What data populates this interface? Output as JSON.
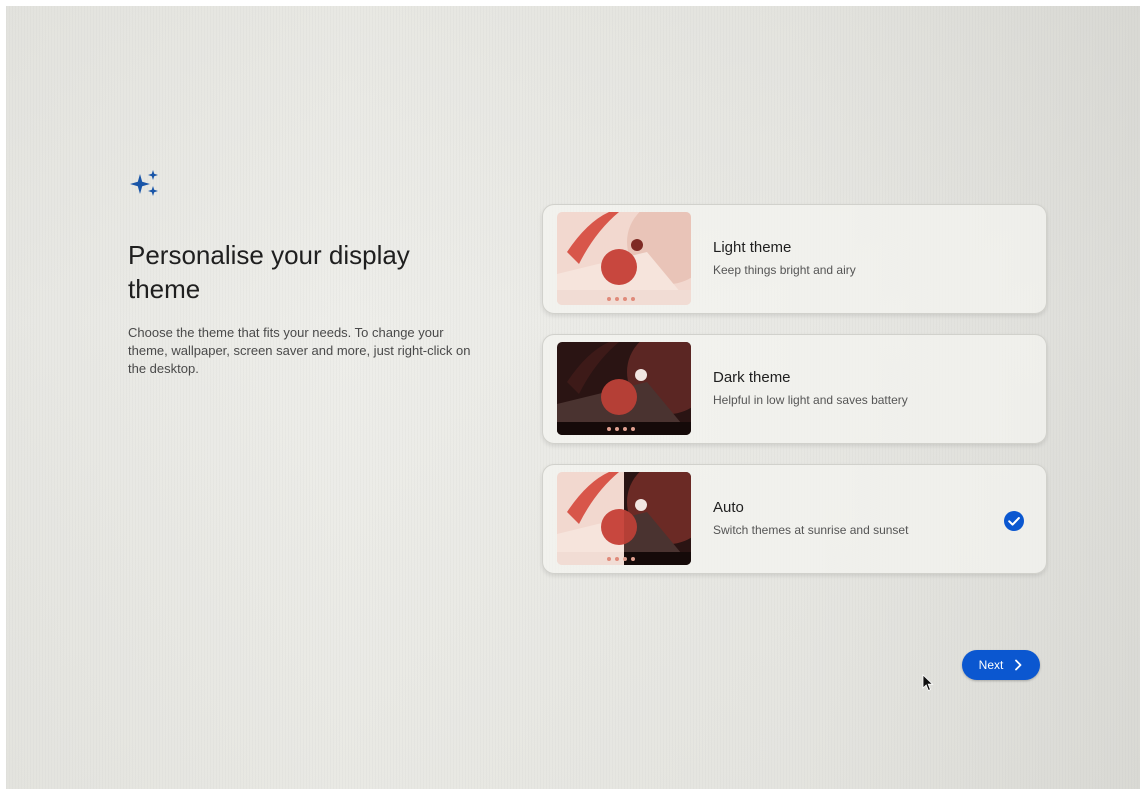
{
  "header": {
    "icon": "sparkle-icon",
    "title": "Personalise your display theme",
    "description": "Choose the theme that fits your needs. To change your theme, wallpaper, screen saver and more, just right-click on the desktop."
  },
  "themes": [
    {
      "title": "Light theme",
      "subtitle": "Keep things bright and airy",
      "preview": "light-wallpaper",
      "selected": false
    },
    {
      "title": "Dark theme",
      "subtitle": "Helpful in low light and saves battery",
      "preview": "dark-wallpaper",
      "selected": false
    },
    {
      "title": "Auto",
      "subtitle": "Switch themes at sunrise and sunset",
      "preview": "auto-wallpaper",
      "selected": true
    }
  ],
  "footer": {
    "next_label": "Next",
    "next_icon": "chevron-right-icon"
  },
  "colors": {
    "accent": "#0b57d0",
    "title_text": "#1f1f1f",
    "body_text": "#4a4a4a",
    "sparkle": "#1a56a8"
  }
}
